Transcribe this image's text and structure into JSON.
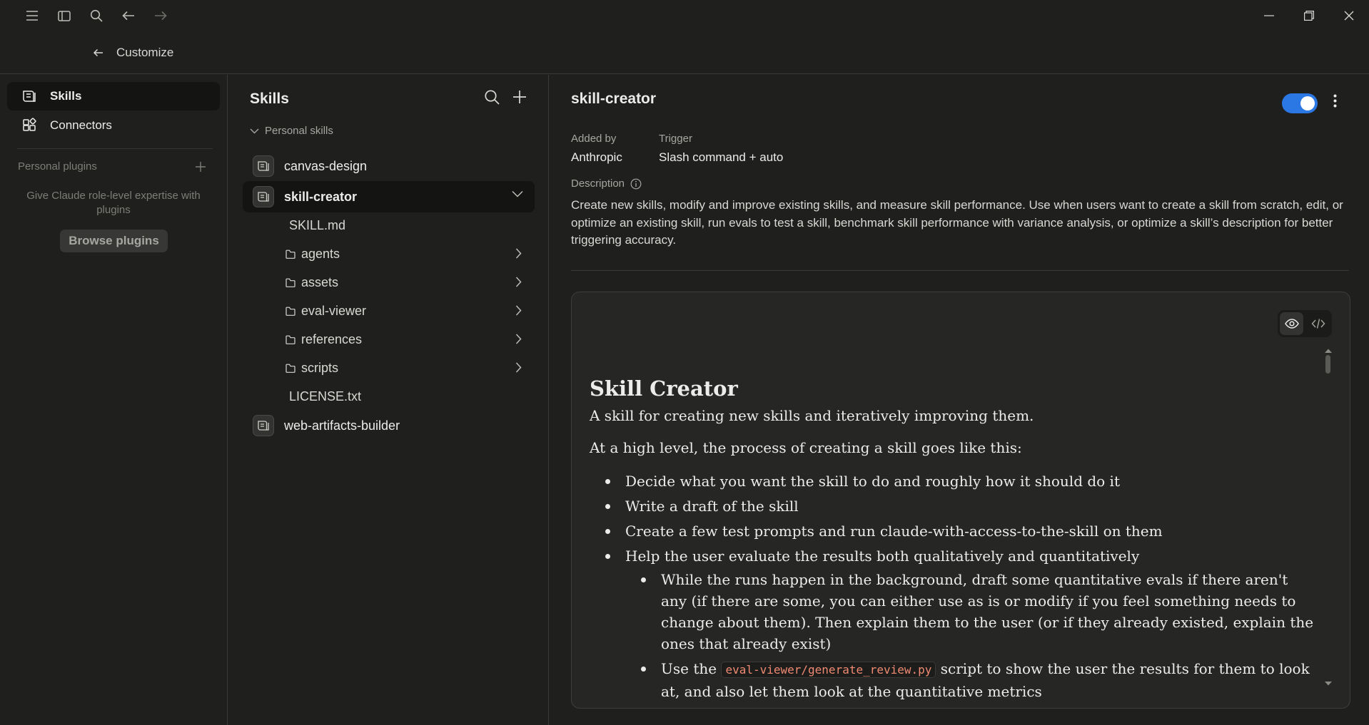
{
  "header": {
    "back_label": "Customize"
  },
  "sidebar": {
    "items": [
      {
        "label": "Skills",
        "icon": "skills-icon",
        "active": true
      },
      {
        "label": "Connectors",
        "icon": "connectors-icon",
        "active": false
      }
    ],
    "personal_plugins_label": "Personal plugins",
    "empty_text": "Give Claude role-level expertise with plugins",
    "browse_label": "Browse plugins"
  },
  "skills_panel": {
    "title": "Skills",
    "group_label": "Personal skills",
    "skills": [
      {
        "name": "canvas-design"
      },
      {
        "name": "skill-creator"
      },
      {
        "name": "web-artifacts-builder"
      }
    ],
    "files": [
      {
        "name": "SKILL.md",
        "type": "file"
      },
      {
        "name": "agents",
        "type": "folder"
      },
      {
        "name": "assets",
        "type": "folder"
      },
      {
        "name": "eval-viewer",
        "type": "folder"
      },
      {
        "name": "references",
        "type": "folder"
      },
      {
        "name": "scripts",
        "type": "folder"
      },
      {
        "name": "LICENSE.txt",
        "type": "file"
      }
    ]
  },
  "detail": {
    "title": "skill-creator",
    "enabled": true,
    "added_by_label": "Added by",
    "added_by_value": "Anthropic",
    "trigger_label": "Trigger",
    "trigger_value": "Slash command + auto",
    "description_label": "Description",
    "description": "Create new skills, modify and improve existing skills, and measure skill performance. Use when users want to create a skill from scratch, edit, or optimize an existing skill, run evals to test a skill, benchmark skill performance with variance analysis, or optimize a skill’s description for better triggering accuracy.",
    "accent_color": "#2b78e4"
  },
  "preview": {
    "heading": "Skill Creator",
    "intro": "A skill for creating new skills and iteratively improving them.",
    "process_intro": "At a high level, the process of creating a skill goes like this:",
    "bullets": [
      "Decide what you want the skill to do and roughly how it should do it",
      "Write a draft of the skill",
      "Create a few test prompts and run claude-with-access-to-the-skill on them",
      "Help the user evaluate the results both qualitatively and quantitatively"
    ],
    "sub_bullet_1": "While the runs happen in the background, draft some quantitative evals if there aren't any (if there are some, you can either use as is or modify if you feel something needs to change about them). Then explain them to the user (or if they already existed, explain the ones that already exist)",
    "sub_bullet_2_pre": "Use the ",
    "sub_bullet_2_code": "eval-viewer/generate_review.py",
    "sub_bullet_2_post": " script to show the user the results for them to look at, and also let them look at the quantitative metrics"
  }
}
